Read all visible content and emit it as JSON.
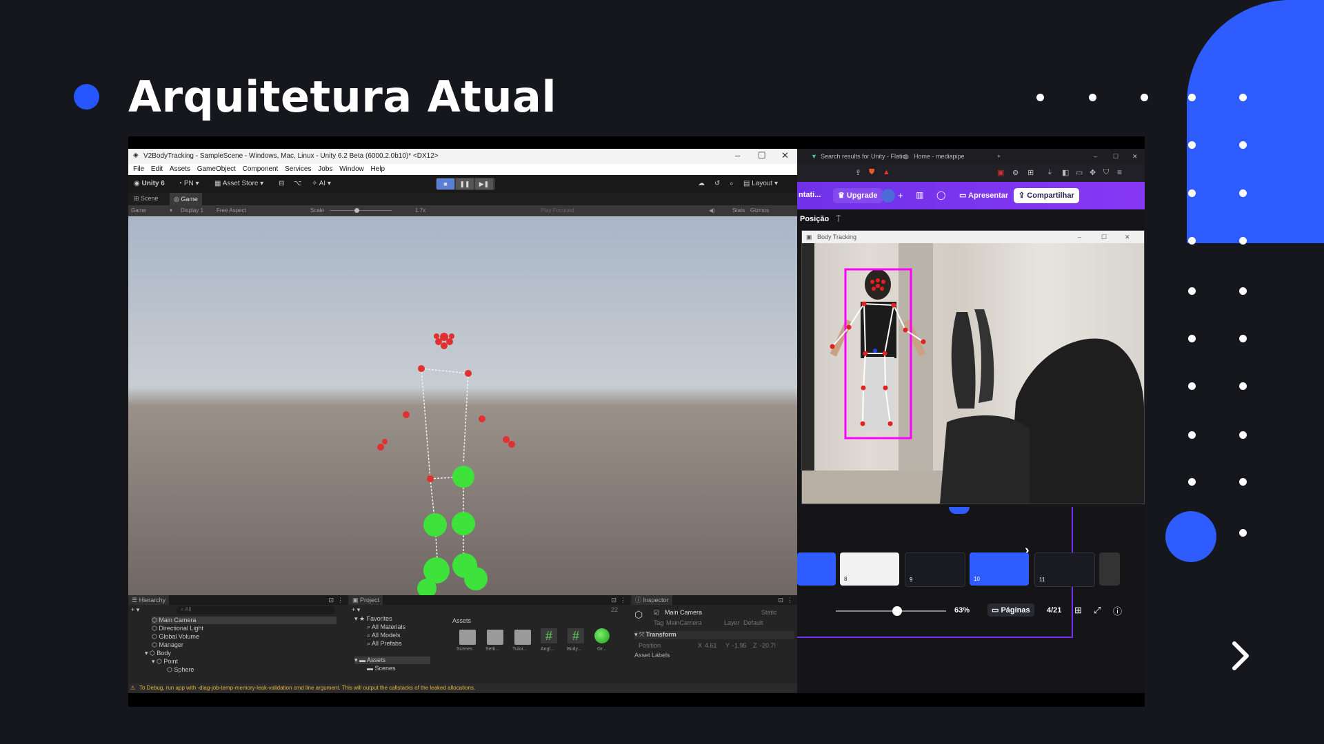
{
  "slide": {
    "title": "Arquitetura Atual",
    "colors": {
      "background": "#16161d",
      "accent": "#2f5cff"
    },
    "next_icon": "chevron-right-icon"
  },
  "unity": {
    "window_title": "V2BodyTracking - SampleScene - Windows, Mac, Linux - Unity 6.2 Beta (6000.2.0b10)* <DX12>",
    "menu": [
      "File",
      "Edit",
      "Assets",
      "GameObject",
      "Component",
      "Services",
      "Jobs",
      "Window",
      "Help"
    ],
    "toolbar": {
      "account": "Unity 6",
      "user": "PN",
      "asset_store": "Asset Store",
      "ai": "AI",
      "layout": "Layout"
    },
    "tabs": {
      "scene": "Scene",
      "game": "Game"
    },
    "gamebar": {
      "game": "Game",
      "display": "Display 1",
      "aspect": "Free Aspect",
      "scale_label": "Scale",
      "scale_value": "1.7x",
      "play_focused": "Play Focused",
      "stats": "Stats",
      "gizmos": "Gizmos"
    },
    "hierarchy": {
      "title": "Hierarchy",
      "search": "All",
      "items": [
        "Main Camera",
        "Directional Light",
        "Global Volume",
        "Manager",
        "Body",
        "Point",
        "Sphere"
      ]
    },
    "project": {
      "title": "Project",
      "favorites": "Favorites",
      "fav_items": [
        "All Materials",
        "All Models",
        "All Prefabs"
      ],
      "assets_folder": "Assets",
      "scenes_folder": "Scenes",
      "assets_header": "Assets",
      "tiles": [
        "Scenes",
        "Setti...",
        "Tutor...",
        "Angl...",
        "Body...",
        "Gr..."
      ],
      "count": "22"
    },
    "inspector": {
      "title": "Inspector",
      "object": "Main Camera",
      "static": "Static",
      "tag_label": "Tag",
      "tag": "MainCamera",
      "layer_label": "Layer",
      "layer": "Default",
      "component": "Transform",
      "position_label": "Position",
      "x_label": "X",
      "pos_x": "4.61",
      "y_label": "Y",
      "pos_y": "-1.95",
      "z_label": "Z",
      "pos_z": "-20.7!",
      "asset_labels": "Asset Labels"
    },
    "status": "To Debug, run app with -diag-job-temp-memory-leak-validation cmd line argument. This will output the callstacks of the leaked allocations."
  },
  "browser": {
    "tab1": "Search results for Unity - Flatic",
    "tab2": "Home - mediapipe",
    "canva": {
      "left_label": "ntati...",
      "upgrade": "Upgrade",
      "present": "Apresentar",
      "share": "Compartilhar",
      "position": "Posição",
      "zoom": "63%",
      "zoom_level": 0.63,
      "pages": "Páginas",
      "page_count": "4/21",
      "thumb_numbers": [
        "8",
        "9",
        "10",
        "11"
      ]
    },
    "camera_window_title": "Body Tracking"
  }
}
